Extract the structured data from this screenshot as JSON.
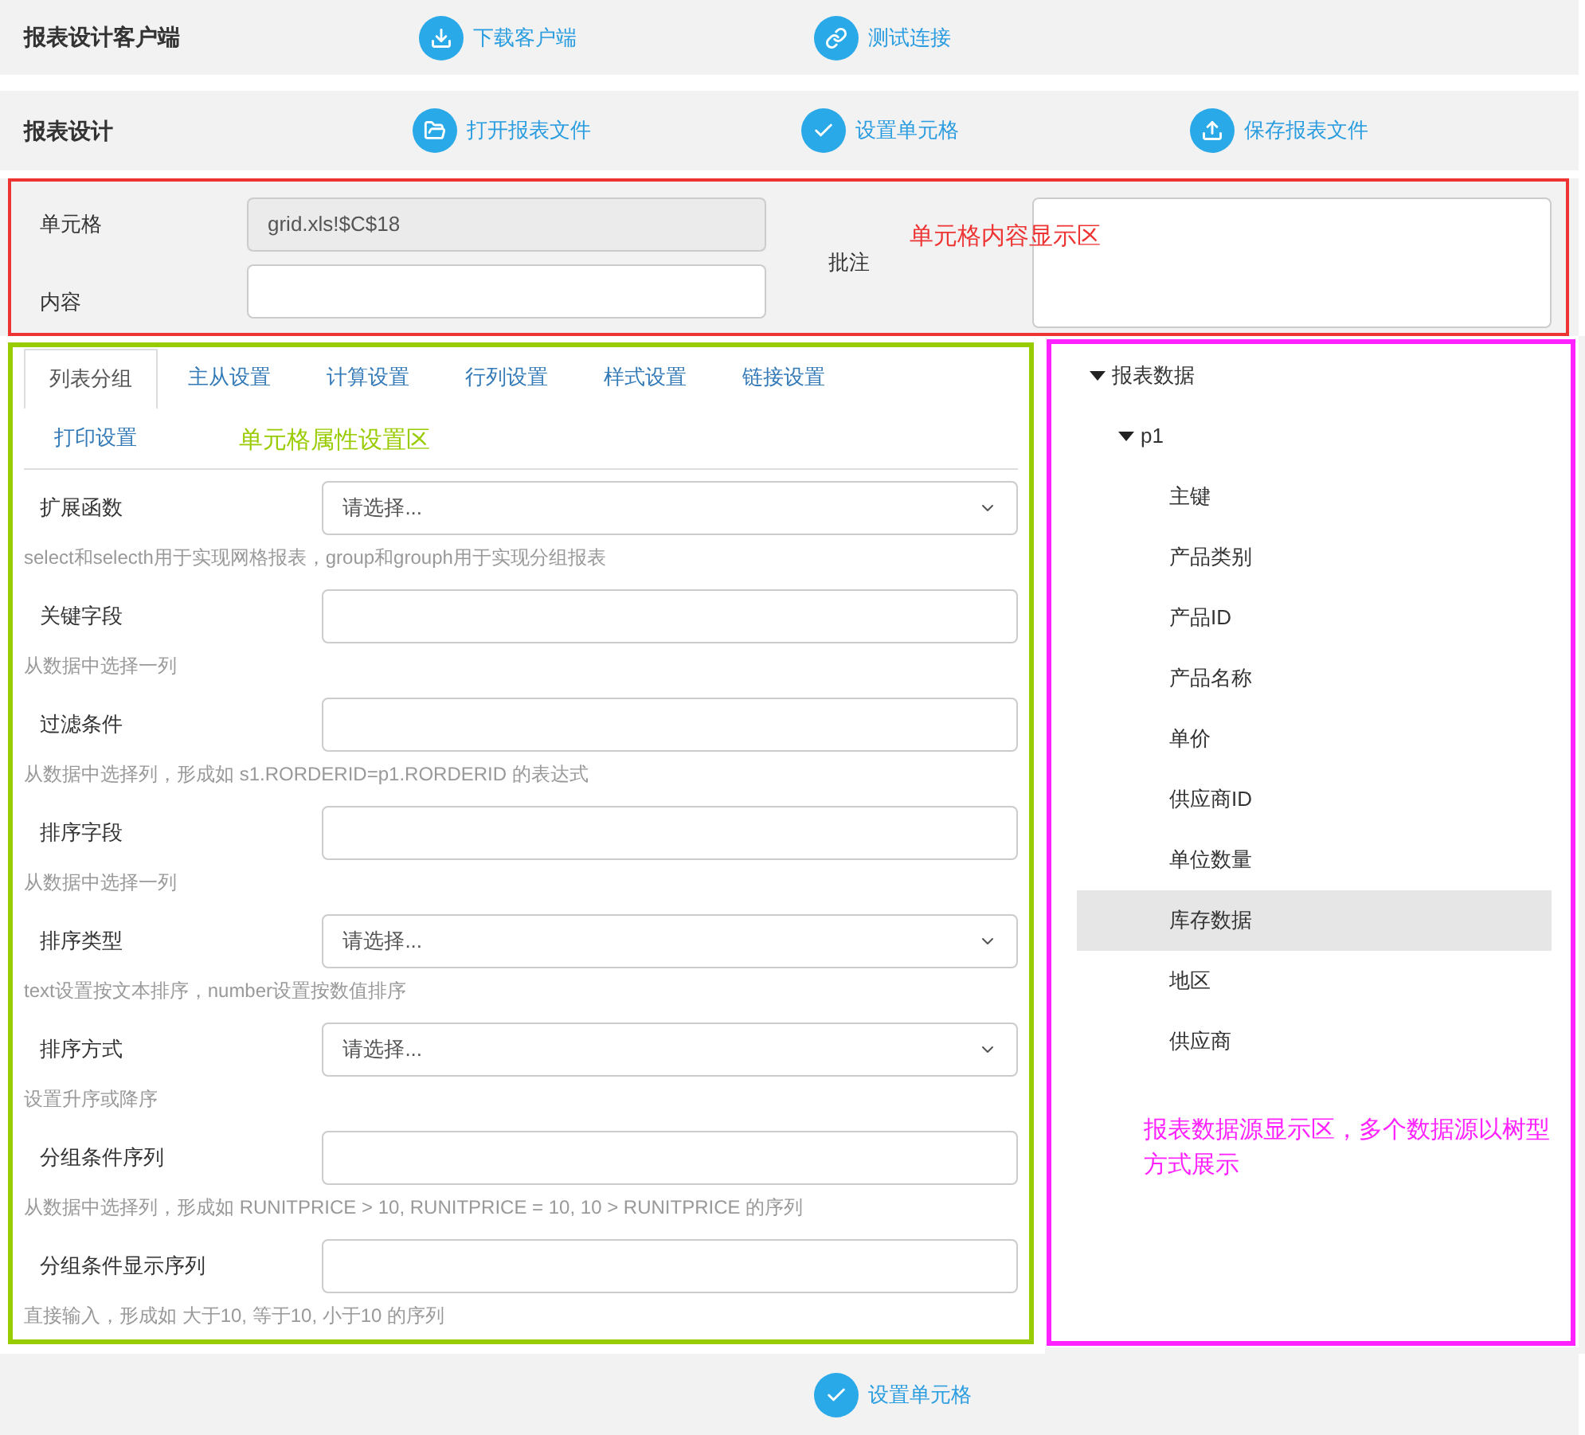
{
  "toolbars": [
    {
      "title": "报表设计客户端",
      "actions": [
        {
          "label": "下载客户端"
        },
        {
          "label": "测试连接"
        }
      ]
    },
    {
      "title": "报表设计",
      "actions": [
        {
          "label": "打开报表文件"
        },
        {
          "label": "设置单元格"
        },
        {
          "label": "保存报表文件"
        }
      ]
    }
  ],
  "cell_panel": {
    "cell_label": "单元格",
    "cell_value": "grid.xls!$C$18",
    "content_label": "内容",
    "note_label": "批注",
    "annotation": {
      "text": "单元格内容显示区",
      "color": "#ee3333"
    }
  },
  "property_panel": {
    "tabs": [
      {
        "label": "列表分组",
        "selected": true
      },
      {
        "label": "主从设置",
        "selected": false
      },
      {
        "label": "计算设置",
        "selected": false
      },
      {
        "label": "行列设置",
        "selected": false
      },
      {
        "label": "样式设置",
        "selected": false
      },
      {
        "label": "链接设置",
        "selected": false
      },
      {
        "label": "打印设置",
        "selected": false
      }
    ],
    "annotation": {
      "text": "单元格属性设置区",
      "color": "#99cc00"
    },
    "fields": [
      {
        "kind": "select",
        "label": "扩展函数",
        "value": "请选择...",
        "hint": "select和selecth用于实现网格报表，group和grouph用于实现分组报表"
      },
      {
        "kind": "input",
        "label": "关键字段",
        "hint": "从数据中选择一列"
      },
      {
        "kind": "input",
        "label": "过滤条件",
        "hint": "从数据中选择列，形成如 s1.RORDERID=p1.RORDERID 的表达式"
      },
      {
        "kind": "input",
        "label": "排序字段",
        "hint": "从数据中选择一列"
      },
      {
        "kind": "select",
        "label": "排序类型",
        "value": "请选择...",
        "hint": "text设置按文本排序，number设置按数值排序"
      },
      {
        "kind": "select",
        "label": "排序方式",
        "value": "请选择...",
        "hint": "设置升序或降序"
      },
      {
        "kind": "input",
        "label": "分组条件序列",
        "hint": "从数据中选择列，形成如 RUNITPRICE > 10, RUNITPRICE = 10, 10 > RUNITPRICE 的序列"
      },
      {
        "kind": "input",
        "label": "分组条件显示序列",
        "hint": "直接输入，形成如 大于10, 等于10, 小于10 的序列"
      }
    ]
  },
  "data_panel": {
    "tree": [
      {
        "label": "报表数据",
        "expanded": true,
        "children": [
          {
            "label": "p1",
            "expanded": true,
            "children": [
              {
                "label": "主键",
                "selected": false
              },
              {
                "label": "产品类别",
                "selected": false
              },
              {
                "label": "产品ID",
                "selected": false
              },
              {
                "label": "产品名称",
                "selected": false
              },
              {
                "label": "单价",
                "selected": false
              },
              {
                "label": "供应商ID",
                "selected": false
              },
              {
                "label": "单位数量",
                "selected": false
              },
              {
                "label": "库存数据",
                "selected": true
              },
              {
                "label": "地区",
                "selected": false
              },
              {
                "label": "供应商",
                "selected": false
              }
            ]
          }
        ]
      }
    ],
    "annotation": {
      "text": "报表数据源显示区，多个数据源以树型方式展示",
      "color": "#ff22ff"
    }
  },
  "footer": {
    "action": {
      "label": "设置单元格"
    }
  }
}
